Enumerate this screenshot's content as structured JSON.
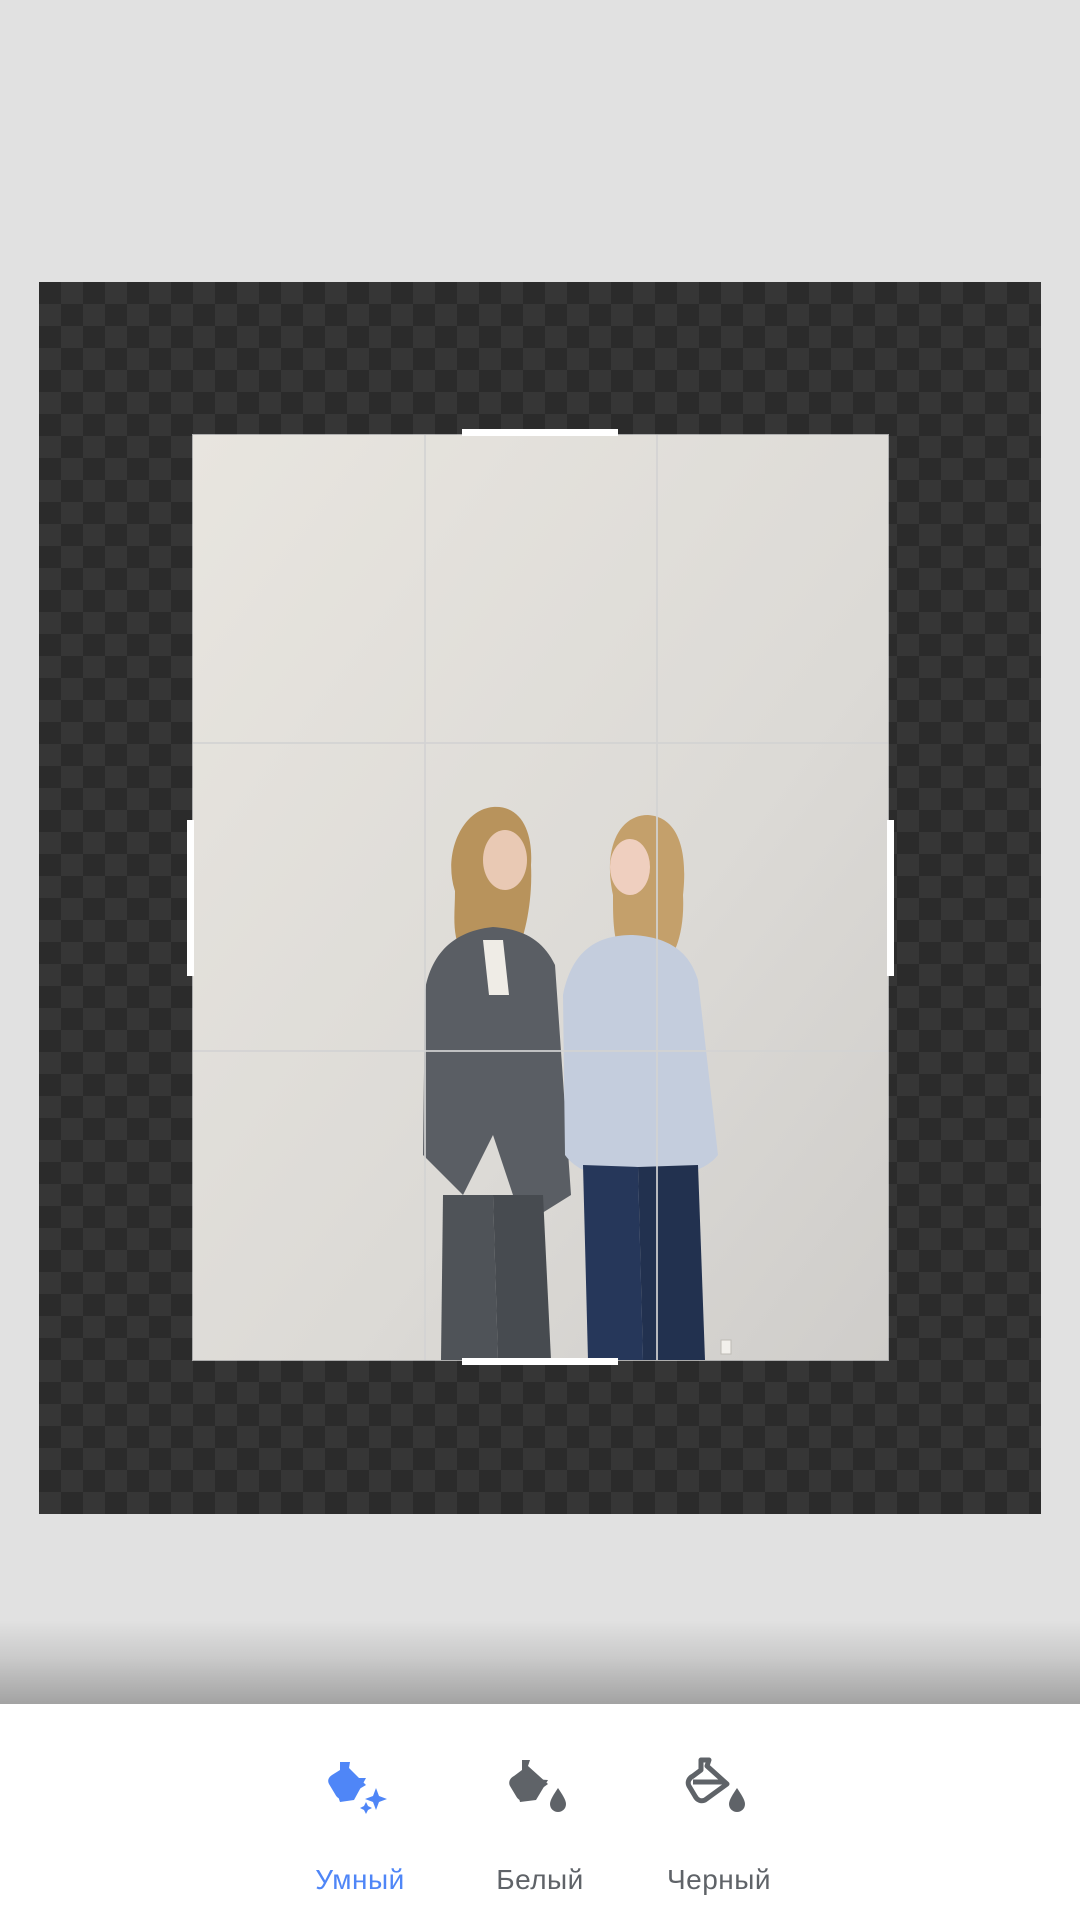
{
  "toolbar": {
    "options": [
      {
        "label": "Умный",
        "icon": "smart-fill-bucket-icon",
        "selected": true
      },
      {
        "label": "Белый",
        "icon": "white-fill-bucket-icon",
        "selected": false
      },
      {
        "label": "Черный",
        "icon": "black-fill-bucket-icon",
        "selected": false
      }
    ]
  },
  "colors": {
    "accent": "#4f86f7",
    "inactive": "#5f6368",
    "canvas_dark": "#2b2b2b",
    "canvas_light": "#363636",
    "background": "#e1e1e1"
  }
}
